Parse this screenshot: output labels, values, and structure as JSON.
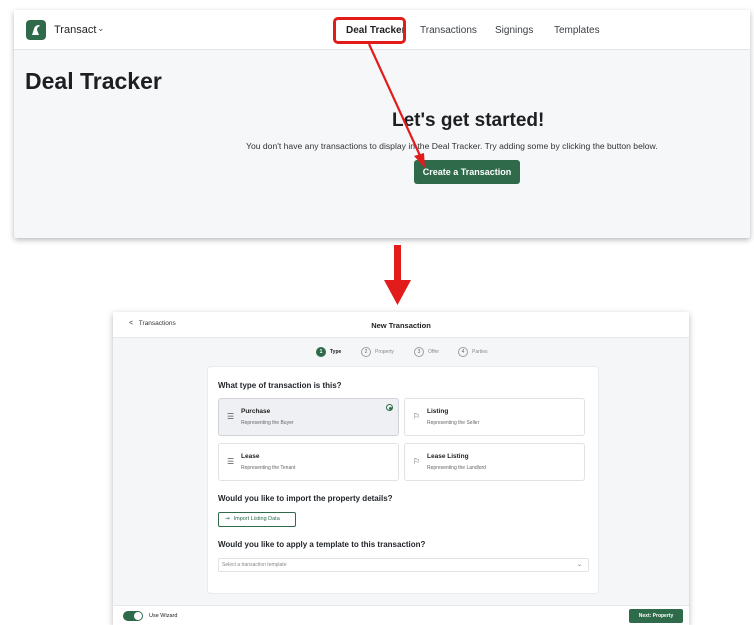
{
  "top": {
    "brand": "Transact",
    "nav": [
      "Deal Tracker",
      "Transactions",
      "Signings",
      "Templates"
    ],
    "page_title": "Deal Tracker",
    "empty_heading": "Let's get started!",
    "empty_message": "You don't have any transactions to display in the Deal Tracker. Try adding some by clicking the button below.",
    "create_button": "Create a Transaction"
  },
  "bottom": {
    "back_label": "Transactions",
    "title": "New Transaction",
    "steps": [
      {
        "num": "1",
        "label": "Type"
      },
      {
        "num": "2",
        "label": "Property"
      },
      {
        "num": "3",
        "label": "Offer"
      },
      {
        "num": "4",
        "label": "Parties"
      }
    ],
    "question_type": "What type of transaction is this?",
    "options": [
      {
        "title": "Purchase",
        "subtitle": "Representing the Buyer"
      },
      {
        "title": "Listing",
        "subtitle": "Representing the Seller"
      },
      {
        "title": "Lease",
        "subtitle": "Representing the Tenant"
      },
      {
        "title": "Lease Listing",
        "subtitle": "Representing the Landlord"
      }
    ],
    "question_import": "Would you like to import the property details?",
    "import_button": "Import Listing Data",
    "question_template": "Would you like to apply a template to this transaction?",
    "template_placeholder": "Select a transaction template",
    "wizard_label": "Use Wizard",
    "next_button": "Next: Property"
  },
  "colors": {
    "accent": "#2f6b4a",
    "highlight": "#e21b1b"
  },
  "icons": [
    "logo-icon",
    "chevron-down-icon",
    "chevron-left-icon",
    "list-icon",
    "flag-icon",
    "import-icon",
    "red-arrow-icon"
  ]
}
